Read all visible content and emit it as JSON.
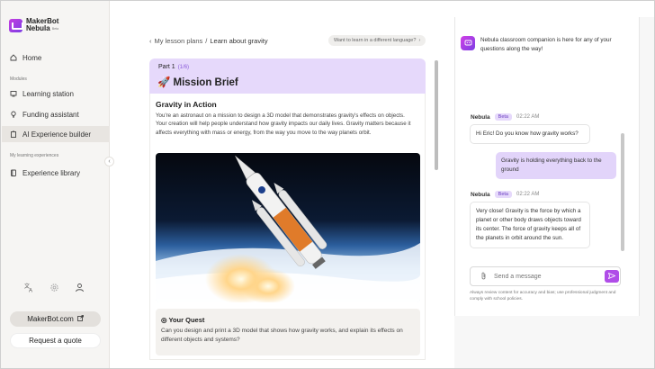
{
  "app": {
    "logo_line1": "MakerBot",
    "logo_line2": "Nebula",
    "logo_badge": "Beta"
  },
  "sidebar": {
    "home": "Home",
    "modules_label": "Modules",
    "modules": [
      "Learning station",
      "Funding assistant",
      "AI Experience builder"
    ],
    "experiences_label": "My learning experiences",
    "library": "Experience library",
    "makerbot_btn": "MakerBot.com",
    "quote_btn": "Request a quote",
    "icons": [
      "translate-icon",
      "settings-icon",
      "user-icon"
    ]
  },
  "main": {
    "breadcrumb_parent": "My lesson plans",
    "breadcrumb_sep": "/",
    "breadcrumb_current": "Learn about gravity",
    "lang_prompt": "Want to learn in a different language?",
    "part_label": "Part 1",
    "part_count": "(1/6)",
    "mission_title": "Mission Brief",
    "section_title": "Gravity in Action",
    "section_text": "You're an astronaut on a mission to design a 3D model that demonstrates gravity's effects on objects. Your creation will help people understand how gravity impacts our daily lives. Gravity matters because it affects everything with mass or energy, from the way you move to the way planets orbit.",
    "quest_title": "Your Quest",
    "quest_text": "Can you design and print a 3D model that shows how gravity works, and explain its effects on different objects and systems?"
  },
  "chat": {
    "intro": "Nebula classroom companion is here for any of your questions along the way!",
    "messages": [
      {
        "sender": "Nebula",
        "badge": "Beta",
        "time": "02:22 AM",
        "text": "Hi Eric! Do you know how gravity works?"
      },
      {
        "sender": "user",
        "text": "Gravity is holding everything back to the ground"
      },
      {
        "sender": "Nebula",
        "badge": "Beta",
        "time": "02:22 AM",
        "text": "Very close! Gravity is the force by which a planet or other body draws objects toward its center. The force of gravity keeps all of the planets in orbit around the sun."
      }
    ],
    "input_placeholder": "Send a message",
    "disclaimer": "Always review content for accuracy and bias; use professional judgment and comply with school policies."
  },
  "colors": {
    "accent": "#b04de8",
    "lavender": "#e6d9fb",
    "sidebar_bg": "#f6f5f3"
  }
}
